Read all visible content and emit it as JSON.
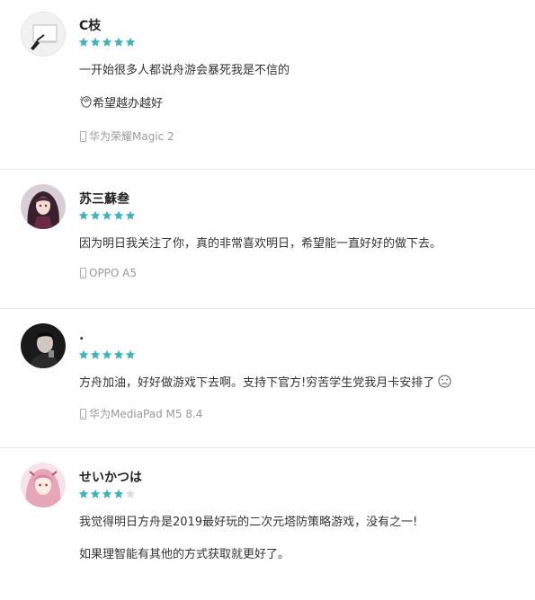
{
  "colors": {
    "star_filled": "#3fb3b9",
    "star_empty": "#dcdcdc",
    "divider": "#e9e9e9",
    "device_text": "#999999"
  },
  "reviews": [
    {
      "username": "C枝",
      "rating": 5,
      "avatar_icon": "pen-sketch-avatar",
      "lines": [
        "一开始很多人都说舟游会暴死我是不信的",
        "希望越办越好"
      ],
      "line_icon": "clapping-hands-icon",
      "device": "华为荣耀Magic 2"
    },
    {
      "username": "苏三蘇叁",
      "rating": 5,
      "avatar_icon": "anime-girl-avatar",
      "lines": [
        "因为明日我关注了你，真的非常喜欢明日，希望能一直好好的做下去。"
      ],
      "device": "OPPO A5"
    },
    {
      "username": ".",
      "rating": 5,
      "avatar_icon": "portrait-avatar",
      "lines": [
        "方舟加油，好好做游戏下去啊。支持下官方!穷苦学生党我月卡安排了"
      ],
      "line_icon": "sad-face-icon",
      "device": "华为MediaPad M5 8.4"
    },
    {
      "username": "せいかつは",
      "rating": 4,
      "avatar_icon": "anime-pink-avatar",
      "lines": [
        "我觉得明日方舟是2019最好玩的二次元塔防策略游戏，没有之一!",
        "如果理智能有其他的方式获取就更好了。"
      ]
    }
  ]
}
